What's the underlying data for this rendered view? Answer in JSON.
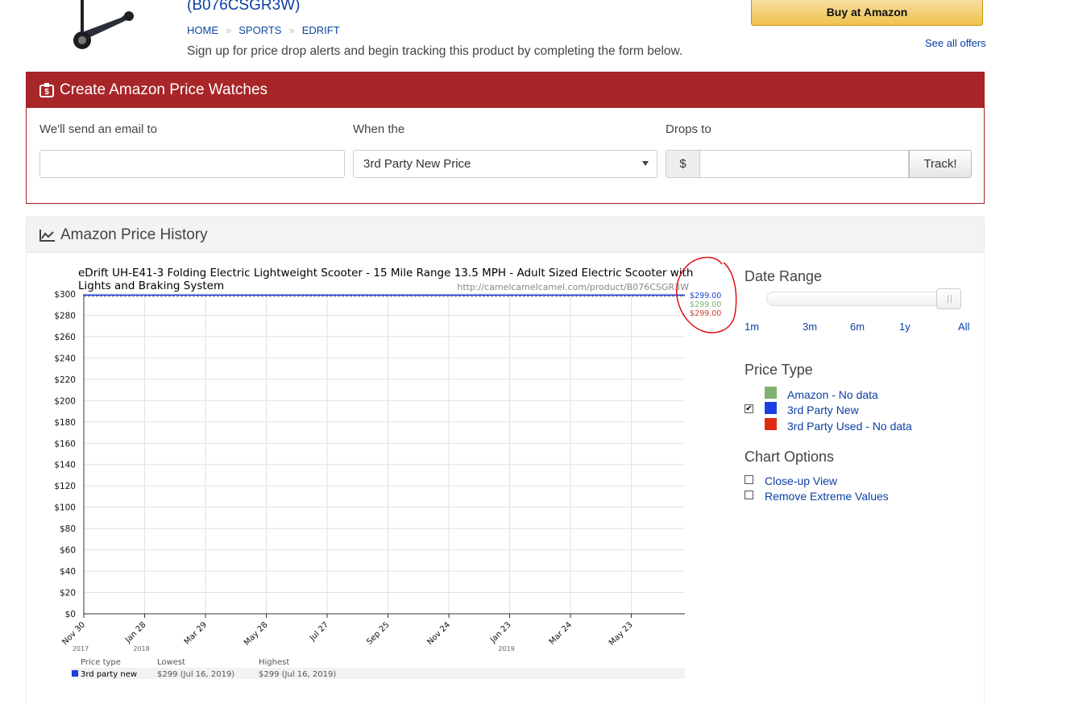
{
  "product": {
    "asin_text": "(B076CSGR3W)",
    "breadcrumb": [
      "HOME",
      "SPORTS",
      "EDRIFT"
    ],
    "signup_text": "Sign up for price drop alerts and begin tracking this product by completing the form below.",
    "buy_button": "Buy at Amazon",
    "see_offers": "See all offers"
  },
  "watch": {
    "title": "Create Amazon Price Watches",
    "email_label": "We'll send an email to",
    "email_value": "",
    "when_label": "When the",
    "when_selected": "3rd Party New Price",
    "drops_label": "Drops to",
    "currency": "$",
    "price_value": "",
    "track_button": "Track!"
  },
  "history": {
    "title": "Amazon Price History",
    "date_range_title": "Date Range",
    "date_ranges": [
      "1m",
      "3m",
      "6m",
      "1y",
      "All"
    ],
    "date_range_selected": "All",
    "price_type_title": "Price Type",
    "price_types": [
      {
        "label": "Amazon - No data",
        "color": "#7fb26f",
        "checked": false
      },
      {
        "label": "3rd Party New",
        "color": "#1b3fe0",
        "checked": true
      },
      {
        "label": "3rd Party Used - No data",
        "color": "#e02b12",
        "checked": false
      }
    ],
    "chart_options_title": "Chart Options",
    "chart_options": [
      {
        "label": "Close-up View",
        "checked": false
      },
      {
        "label": "Remove Extreme Values",
        "checked": false
      }
    ]
  },
  "chart_data": {
    "type": "line",
    "title": "eDrift UH-E41-3 Folding Electric Lightweight Scooter - 15 Mile Range 13.5 MPH - Adult Sized Electric Scooter with Lights and Braking System",
    "watermark": "http://camelcamelcamel.com/product/B076CSGR3W",
    "ylim": [
      0,
      300
    ],
    "y_ticks": [
      "$0",
      "$20",
      "$40",
      "$60",
      "$80",
      "$100",
      "$120",
      "$140",
      "$160",
      "$180",
      "$200",
      "$220",
      "$240",
      "$260",
      "$280",
      "$300"
    ],
    "x_ticks": [
      "Nov 30",
      "Jan 28",
      "Mar 29",
      "May 28",
      "Jul 27",
      "Sep 25",
      "Nov 24",
      "Jan 23",
      "Mar 24",
      "May 23"
    ],
    "x_years": [
      {
        "label": "2017",
        "under": "Nov 30"
      },
      {
        "label": "2018",
        "under": "Jan 28"
      },
      {
        "label": "2019",
        "under": "Jan 23"
      }
    ],
    "series": [
      {
        "name": "3rd party new",
        "color": "#1b3fe0",
        "x": [
          "2017-11-30",
          "2019-07-16"
        ],
        "values": [
          299,
          299
        ]
      }
    ],
    "end_labels": [
      {
        "text": "$299.00",
        "color": "#1b3fe0"
      },
      {
        "text": "$299.00",
        "color": "#7fb26f"
      },
      {
        "text": "$299.00",
        "color": "#c83a2a"
      }
    ],
    "summary": {
      "headers": [
        "Price type",
        "Lowest",
        "Highest"
      ],
      "rows": [
        [
          "3rd party new",
          "$299 (Jul 16, 2019)",
          "$299 (Jul 16, 2019)"
        ]
      ]
    }
  }
}
